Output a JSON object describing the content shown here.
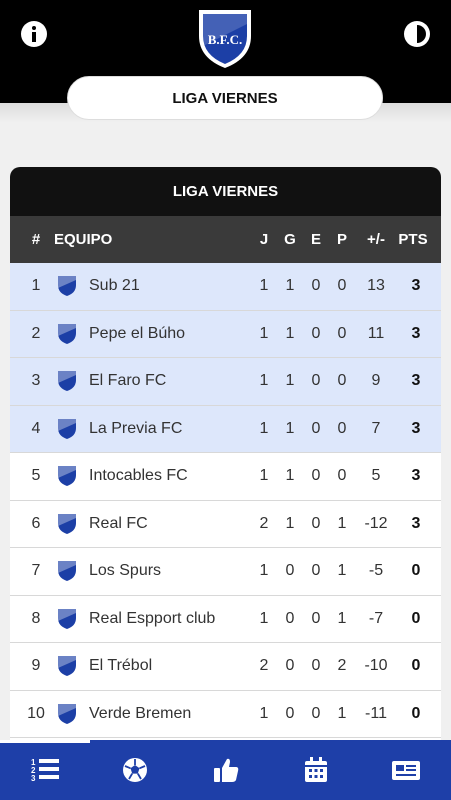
{
  "header": {
    "logo_text": "B.F.C.",
    "league_selector_label": "LIGA VIERNES"
  },
  "standings": {
    "title": "LIGA VIERNES",
    "columns": {
      "pos": "#",
      "team": "EQUIPO",
      "j": "J",
      "g": "G",
      "e": "E",
      "p": "P",
      "diff": "+/-",
      "pts": "PTS"
    },
    "rows": [
      {
        "pos": "1",
        "team": "Sub 21",
        "j": "1",
        "g": "1",
        "e": "0",
        "p": "0",
        "diff": "13",
        "pts": "3"
      },
      {
        "pos": "2",
        "team": "Pepe el Búho",
        "j": "1",
        "g": "1",
        "e": "0",
        "p": "0",
        "diff": "11",
        "pts": "3"
      },
      {
        "pos": "3",
        "team": "El Faro FC",
        "j": "1",
        "g": "1",
        "e": "0",
        "p": "0",
        "diff": "9",
        "pts": "3"
      },
      {
        "pos": "4",
        "team": "La Previa FC",
        "j": "1",
        "g": "1",
        "e": "0",
        "p": "0",
        "diff": "7",
        "pts": "3"
      },
      {
        "pos": "5",
        "team": "Intocables FC",
        "j": "1",
        "g": "1",
        "e": "0",
        "p": "0",
        "diff": "5",
        "pts": "3"
      },
      {
        "pos": "6",
        "team": "Real FC",
        "j": "2",
        "g": "1",
        "e": "0",
        "p": "1",
        "diff": "-12",
        "pts": "3"
      },
      {
        "pos": "7",
        "team": "Los Spurs",
        "j": "1",
        "g": "0",
        "e": "0",
        "p": "1",
        "diff": "-5",
        "pts": "0"
      },
      {
        "pos": "8",
        "team": "Real Espport club",
        "j": "1",
        "g": "0",
        "e": "0",
        "p": "1",
        "diff": "-7",
        "pts": "0"
      },
      {
        "pos": "9",
        "team": "El Trébol",
        "j": "2",
        "g": "0",
        "e": "0",
        "p": "2",
        "diff": "-10",
        "pts": "0"
      },
      {
        "pos": "10",
        "team": "Verde Bremen",
        "j": "1",
        "g": "0",
        "e": "0",
        "p": "1",
        "diff": "-11",
        "pts": "0"
      }
    ]
  },
  "bottom_nav": {
    "items": [
      {
        "icon": "standings-list-icon",
        "active": true
      },
      {
        "icon": "soccer-ball-icon",
        "active": false
      },
      {
        "icon": "thumbs-up-icon",
        "active": false
      },
      {
        "icon": "calendar-icon",
        "active": false
      },
      {
        "icon": "newspaper-icon",
        "active": false
      }
    ]
  },
  "colors": {
    "topbar": "#000000",
    "nav_background": "#1e3fa8",
    "highlight_row": "#dde7fb",
    "table_header": "#3a3a3a",
    "shield_blue": "#1c3fa6"
  }
}
